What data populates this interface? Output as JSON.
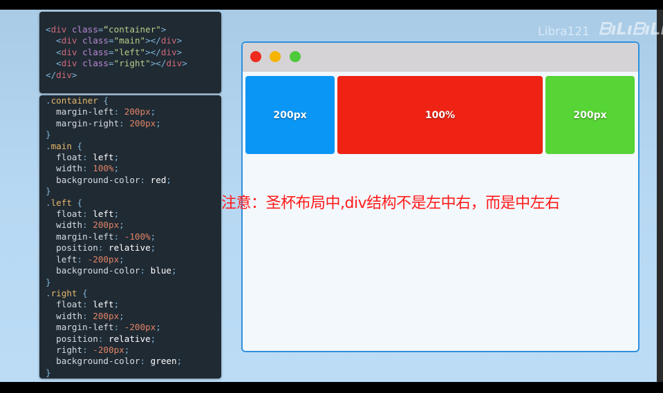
{
  "html_code": [
    [
      [
        "<",
        "tag"
      ],
      [
        "div ",
        "name"
      ],
      [
        "class",
        "attr"
      ],
      [
        "=",
        "tag"
      ],
      [
        "“container\"",
        "str"
      ],
      [
        ">",
        "tag"
      ]
    ],
    [
      [
        "  <",
        "tag"
      ],
      [
        "div ",
        "name"
      ],
      [
        "class",
        "attr"
      ],
      [
        "=",
        "tag"
      ],
      [
        "\"main\"",
        "str"
      ],
      [
        "></",
        "tag"
      ],
      [
        "div",
        "name"
      ],
      [
        ">",
        "tag"
      ]
    ],
    [
      [
        "  <",
        "tag"
      ],
      [
        "div ",
        "name"
      ],
      [
        "class",
        "attr"
      ],
      [
        "=",
        "tag"
      ],
      [
        "\"left\"",
        "str"
      ],
      [
        "></",
        "tag"
      ],
      [
        "div",
        "name"
      ],
      [
        ">",
        "tag"
      ]
    ],
    [
      [
        "  <",
        "tag"
      ],
      [
        "div ",
        "name"
      ],
      [
        "class",
        "attr"
      ],
      [
        "=",
        "tag"
      ],
      [
        "\"right\"",
        "str"
      ],
      [
        "></",
        "tag"
      ],
      [
        "div",
        "name"
      ],
      [
        ">",
        "tag"
      ]
    ],
    [
      [
        "</",
        "tag"
      ],
      [
        "div",
        "name"
      ],
      [
        ">",
        "tag"
      ]
    ]
  ],
  "css_code": [
    [
      [
        ".",
        "punc"
      ],
      [
        "container",
        "sel"
      ],
      [
        " {",
        "punc"
      ]
    ],
    [
      [
        "  margin-left",
        "prop"
      ],
      [
        ": ",
        "punc"
      ],
      [
        "200px",
        "num"
      ],
      [
        ";",
        "punc"
      ]
    ],
    [
      [
        "  margin-right",
        "prop"
      ],
      [
        ": ",
        "punc"
      ],
      [
        "200px",
        "num"
      ],
      [
        ";",
        "punc"
      ]
    ],
    [
      [
        "}",
        "punc"
      ]
    ],
    [
      [
        ".",
        "punc"
      ],
      [
        "main",
        "sel"
      ],
      [
        " {",
        "punc"
      ]
    ],
    [
      [
        "  float",
        "prop"
      ],
      [
        ": ",
        "punc"
      ],
      [
        "left",
        "val"
      ],
      [
        ";",
        "punc"
      ]
    ],
    [
      [
        "  width",
        "prop"
      ],
      [
        ": ",
        "punc"
      ],
      [
        "100%",
        "num"
      ],
      [
        ";",
        "punc"
      ]
    ],
    [
      [
        "  background-color",
        "prop"
      ],
      [
        ": ",
        "punc"
      ],
      [
        "red",
        "val"
      ],
      [
        ";",
        "punc"
      ]
    ],
    [
      [
        "}",
        "punc"
      ]
    ],
    [
      [
        ".",
        "punc"
      ],
      [
        "left",
        "sel"
      ],
      [
        " {",
        "punc"
      ]
    ],
    [
      [
        "  float",
        "prop"
      ],
      [
        ": ",
        "punc"
      ],
      [
        "left",
        "val"
      ],
      [
        ";",
        "punc"
      ]
    ],
    [
      [
        "  width",
        "prop"
      ],
      [
        ": ",
        "punc"
      ],
      [
        "200px",
        "num"
      ],
      [
        ";",
        "punc"
      ]
    ],
    [
      [
        "  margin-left",
        "prop"
      ],
      [
        ": ",
        "punc"
      ],
      [
        "-100%",
        "num"
      ],
      [
        ";",
        "punc"
      ]
    ],
    [
      [
        "  position",
        "prop"
      ],
      [
        ": ",
        "punc"
      ],
      [
        "relative",
        "val"
      ],
      [
        ";",
        "punc"
      ]
    ],
    [
      [
        "  left",
        "prop"
      ],
      [
        ": ",
        "punc"
      ],
      [
        "-200px",
        "num"
      ],
      [
        ";",
        "punc"
      ]
    ],
    [
      [
        "  background-color",
        "prop"
      ],
      [
        ": ",
        "punc"
      ],
      [
        "blue",
        "val"
      ],
      [
        ";",
        "punc"
      ]
    ],
    [
      [
        "}",
        "punc"
      ]
    ],
    [
      [
        ".",
        "punc"
      ],
      [
        "right",
        "sel"
      ],
      [
        " {",
        "punc"
      ]
    ],
    [
      [
        "  float",
        "prop"
      ],
      [
        ": ",
        "punc"
      ],
      [
        "left",
        "val"
      ],
      [
        ";",
        "punc"
      ]
    ],
    [
      [
        "  width",
        "prop"
      ],
      [
        ": ",
        "punc"
      ],
      [
        "200px",
        "num"
      ],
      [
        ";",
        "punc"
      ]
    ],
    [
      [
        "  margin-left",
        "prop"
      ],
      [
        ": ",
        "punc"
      ],
      [
        "-200px",
        "num"
      ],
      [
        ";",
        "punc"
      ]
    ],
    [
      [
        "  position",
        "prop"
      ],
      [
        ": ",
        "punc"
      ],
      [
        "relative",
        "val"
      ],
      [
        ";",
        "punc"
      ]
    ],
    [
      [
        "  right",
        "prop"
      ],
      [
        ": ",
        "punc"
      ],
      [
        "-200px",
        "num"
      ],
      [
        ";",
        "punc"
      ]
    ],
    [
      [
        "  background-color",
        "prop"
      ],
      [
        ": ",
        "punc"
      ],
      [
        "green",
        "val"
      ],
      [
        ";",
        "punc"
      ]
    ],
    [
      [
        "}",
        "punc"
      ]
    ]
  ],
  "watermark": {
    "user": "Libra121",
    "logo": "bilibili"
  },
  "browser": {
    "dots": [
      "#ee2a1e",
      "#f5b400",
      "#4dc93a"
    ],
    "boxes": [
      {
        "label": "200px",
        "color": "#0a96f5"
      },
      {
        "label": "100%",
        "color": "#ee2314"
      },
      {
        "label": "200px",
        "color": "#57d436"
      }
    ]
  },
  "note": "注意：圣杯布局中,div结构不是左中右，而是中左右"
}
